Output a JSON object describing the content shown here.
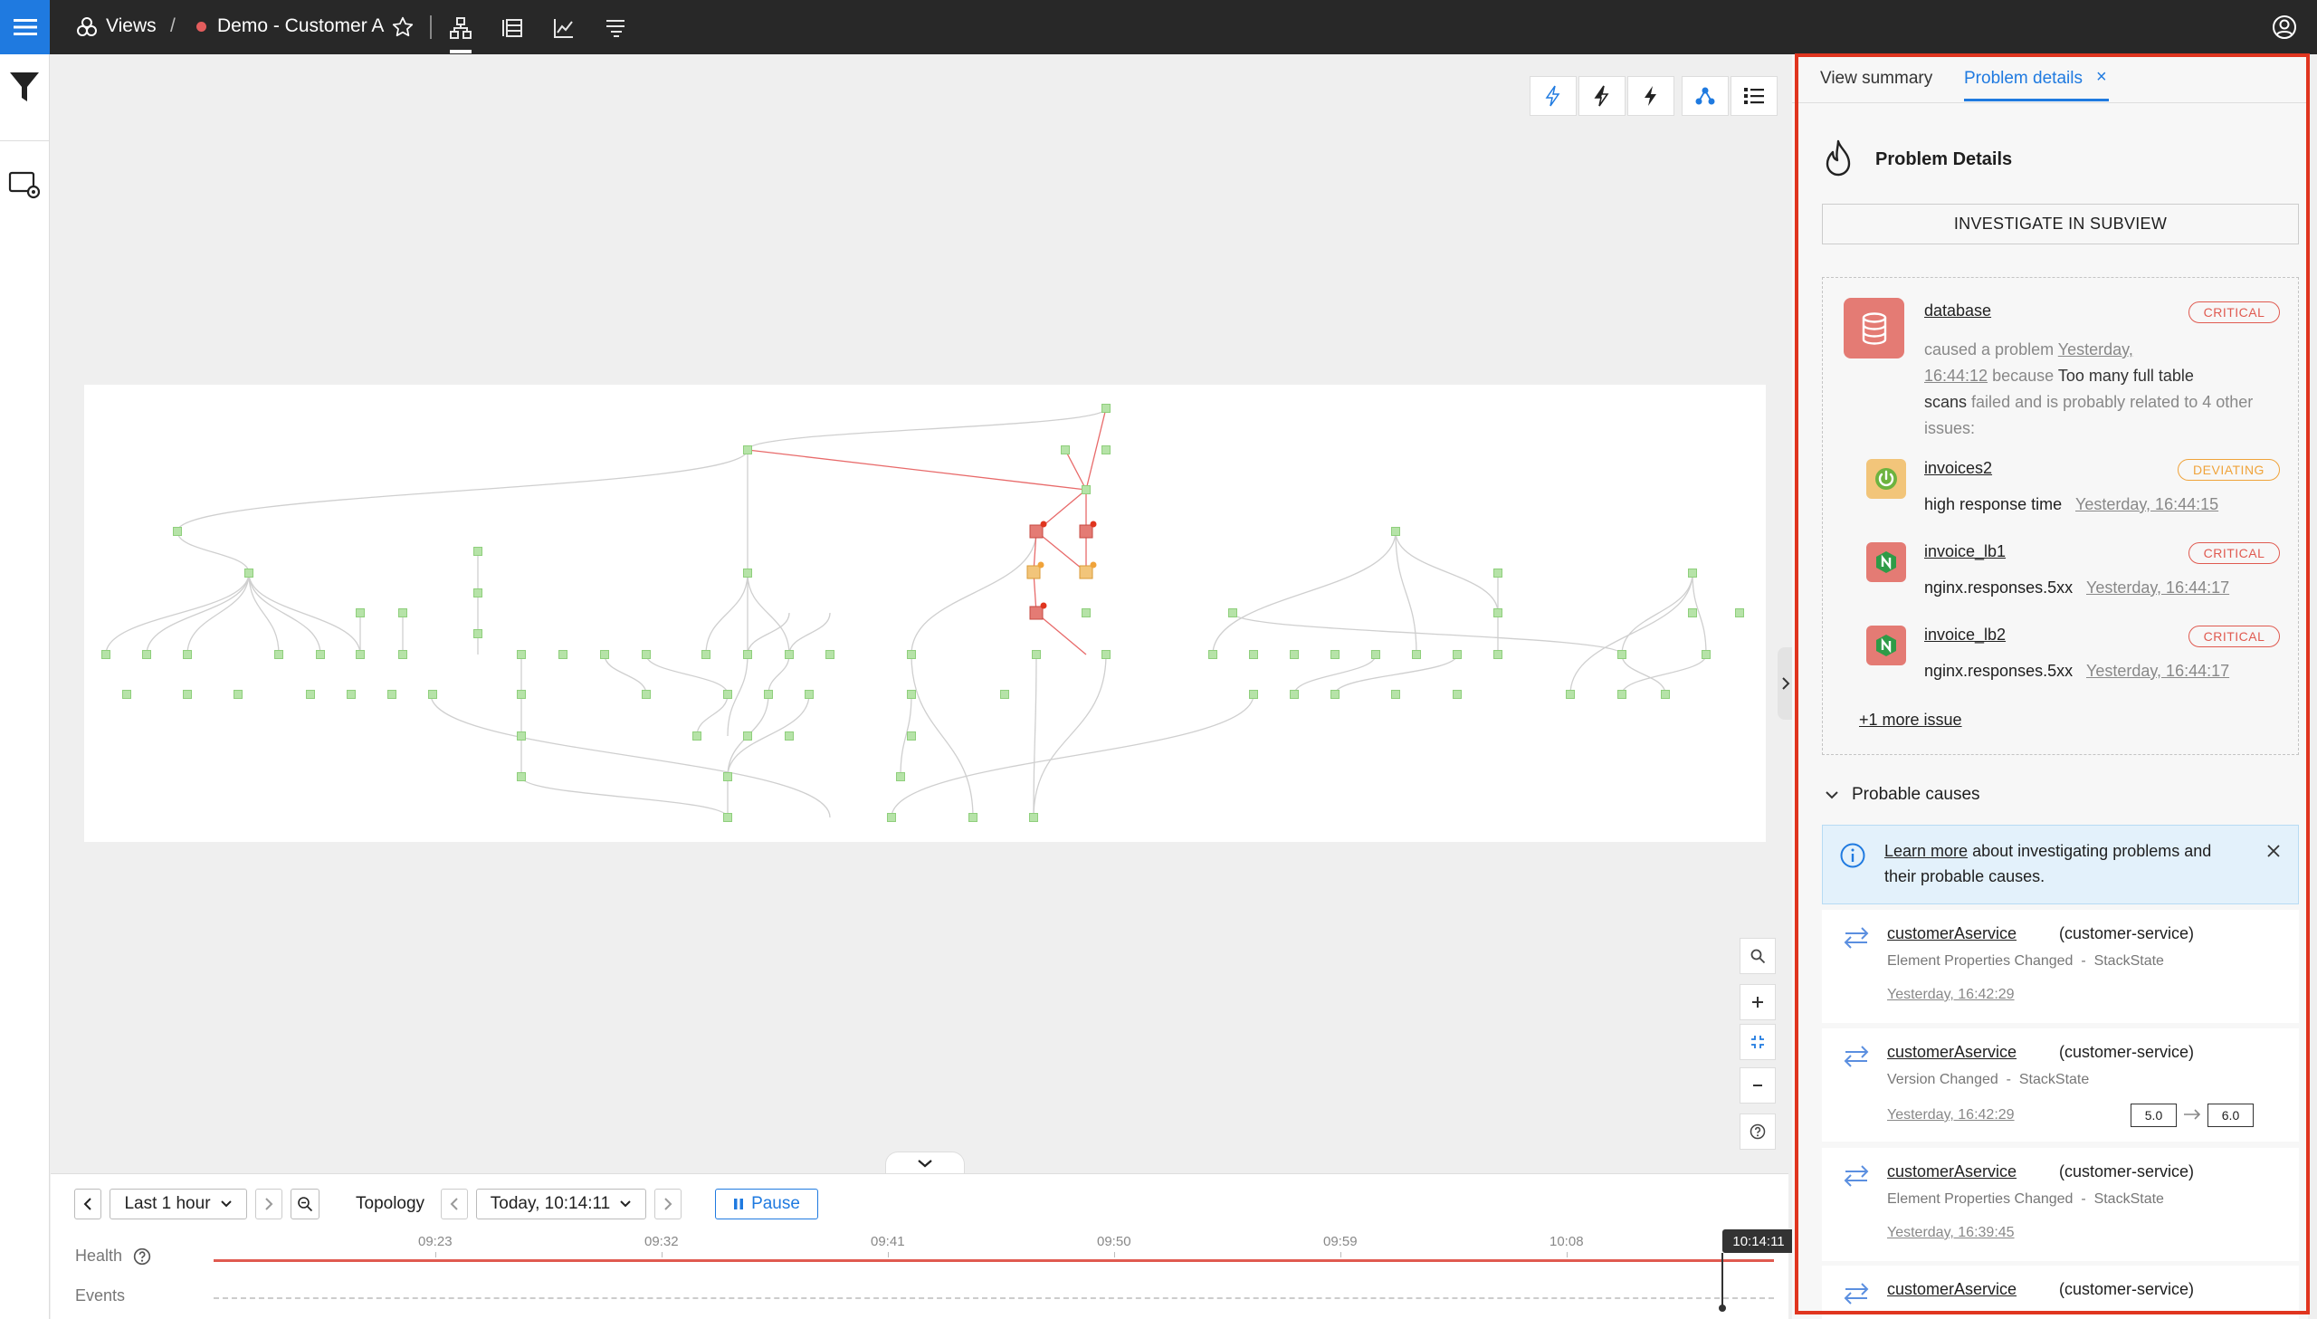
{
  "topbar": {
    "views_label": "Views",
    "separator": "/",
    "view_name": "Demo - Customer A",
    "status_color": "#e35d5d"
  },
  "timeline": {
    "range_label": "Last 1 hour",
    "mode_label": "Topology",
    "time_label": "Today, 10:14:11",
    "pause_label": "Pause",
    "ticks": [
      "09:23",
      "09:32",
      "09:41",
      "09:50",
      "09:59",
      "10:08"
    ],
    "cursor_label": "10:14:11",
    "health_label": "Health",
    "events_label": "Events"
  },
  "panel": {
    "tabs": [
      {
        "label": "View summary"
      },
      {
        "label": "Problem details",
        "close": "×"
      }
    ],
    "title": "Problem Details",
    "investigate_label": "INVESTIGATE IN SUBVIEW",
    "root": {
      "name": "database",
      "badge": "CRITICAL",
      "text_caused": "caused a problem",
      "time_part1": "Yesterday,",
      "time_part2": "16:44:12",
      "text_because": "because",
      "check_part1": "Too many full table",
      "check_part2": "scans",
      "text_tail_1": "failed and is probably related to 4 other",
      "text_tail_2": "issues:"
    },
    "related": [
      {
        "name": "invoices2",
        "badge": "DEVIATING",
        "check": "high response time",
        "time": "Yesterday, 16:44:15"
      },
      {
        "name": "invoice_lb1",
        "badge": "CRITICAL",
        "check": "nginx.responses.5xx",
        "time": "Yesterday, 16:44:17"
      },
      {
        "name": "invoice_lb2",
        "badge": "CRITICAL",
        "check": "nginx.responses.5xx",
        "time": "Yesterday, 16:44:17"
      }
    ],
    "more_issues": "+1 more issue",
    "probable_causes_label": "Probable causes",
    "info": {
      "link": "Learn more",
      "text_1": "about investigating problems and",
      "text_2": "their probable causes."
    },
    "causes": [
      {
        "name": "customerAservice",
        "type": "(customer-service)",
        "desc": "Element Properties Changed",
        "sep": "-",
        "source": "StackState",
        "time": "Yesterday, 16:42:29"
      },
      {
        "name": "customerAservice",
        "type": "(customer-service)",
        "desc": "Version Changed",
        "sep": "-",
        "source": "StackState",
        "time": "Yesterday, 16:42:29",
        "from": "5.0",
        "to": "6.0"
      },
      {
        "name": "customerAservice",
        "type": "(customer-service)",
        "desc": "Element Properties Changed",
        "sep": "-",
        "source": "StackState",
        "time": "Yesterday, 16:39:45"
      },
      {
        "name": "customerAservice",
        "type": "(customer-service)"
      }
    ]
  },
  "colors": {
    "accent": "#1f7ae0",
    "critical": "#e05a50",
    "deviating": "#f0a33a",
    "highlight_border": "#e0351f",
    "node_ok": "#b6e3a8"
  }
}
